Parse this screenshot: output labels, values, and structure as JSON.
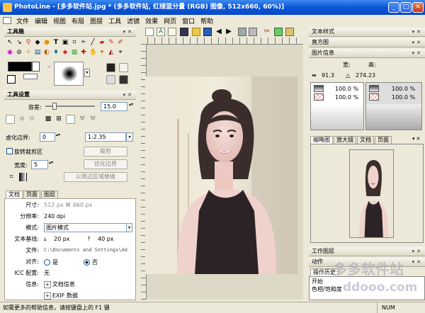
{
  "window": {
    "title": "PhotoLine - [多多软件站.jpg * (多多软件站, 红绿蓝分量 (RGB) 图像, 512x660, 60%)]",
    "minimize": "_",
    "maximize": "□",
    "close": "✕"
  },
  "menu": [
    "文件",
    "编辑",
    "视图",
    "布局",
    "图层",
    "工具",
    "滤镜",
    "效果",
    "网页",
    "窗口",
    "帮助"
  ],
  "toolbox": {
    "title": "工具箱"
  },
  "tool_settings": {
    "title": "工具设置",
    "tolerance_label": "容差:",
    "tolerance_value": "15.0",
    "virtual_border_label": "虚化边界:",
    "virtual_border_value": "0",
    "ratio_value": "1:2.35",
    "rotate_crop_label": "旋转裁剪区",
    "crop_button": "裁剪",
    "optimize_button": "优化边界",
    "width_label": "宽度:",
    "width_value": "5",
    "replace_button": "以周边区域替换"
  },
  "doc_info": {
    "tabs": [
      "文档",
      "页面",
      "图层"
    ],
    "size_label": "尺寸:",
    "size_value": "512 px ⌘ 660 px",
    "resolution_label": "分辨率:",
    "resolution_value": "240 dpi",
    "mode_label": "模式:",
    "mode_value": "图片模式",
    "baseline_label": "文本基线:",
    "baseline_a": "20 px",
    "baseline_b": "40 px",
    "file_label": "文件:",
    "file_value": "C:\\Documents and Settings\\Ad",
    "align_label": "对齐:",
    "align_yes": "是",
    "align_no": "否",
    "icc_label": "ICC 配置:",
    "icc_value": "无",
    "info_label": "信息:",
    "info_items": [
      "文档信息",
      "EXIF 数据"
    ]
  },
  "right_panels": {
    "text_style": "文本样式",
    "histogram": "直方图",
    "image_info": "图片信息",
    "info_w_label": "宽:",
    "info_h_label": "高:",
    "info_x": "91.3",
    "info_angle": "274.23",
    "layer_pct_1": "100.0 %",
    "layer_pct_2": "100.0 %",
    "layer_pct_3": "100.0 %",
    "layer_pct_4": "100.0 %",
    "preview_tabs": [
      "缩略图",
      "放大镜",
      "文档",
      "页面"
    ],
    "work_layers": "工作图层",
    "actions": "动作",
    "history": "操作历史",
    "history_items": [
      "开始",
      "色相/饱和度"
    ]
  },
  "status": {
    "text": "如需更多的帮助信息，请按键盘上的 F1 键",
    "indicator": "NUM"
  },
  "watermark": {
    "line1": "多多软件站",
    "line2": "ddooo.com"
  }
}
